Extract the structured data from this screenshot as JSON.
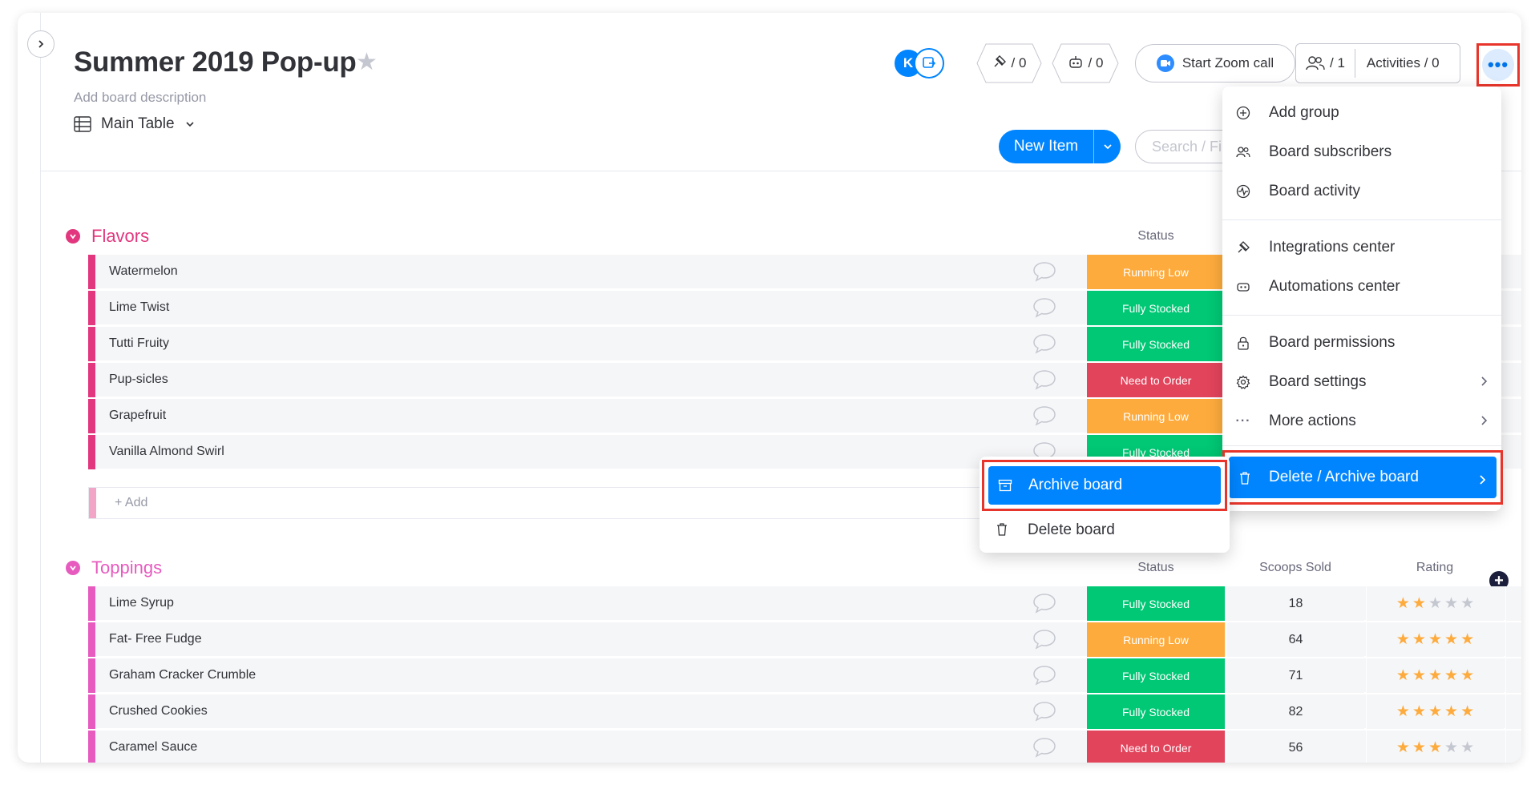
{
  "board": {
    "title": "Summer 2019 Pop-up",
    "description_placeholder": "Add board description",
    "avatar_initial": "K"
  },
  "header": {
    "integrations_count": "/ 0",
    "automations_count": "/ 0",
    "zoom_label": "Start Zoom call",
    "members_count": "/ 1",
    "activities_label": "Activities / 0"
  },
  "view": {
    "name": "Main Table"
  },
  "toolbar": {
    "new_item": "New Item",
    "search_placeholder": "Search / Fi"
  },
  "groups": [
    {
      "name": "Flavors",
      "color": "#e2445c",
      "bar_color": "#e2377e",
      "status_header": "Status",
      "add_label": "+ Add",
      "rows": [
        {
          "name": "Watermelon",
          "status": "Running Low",
          "status_color": "#fdab3d"
        },
        {
          "name": "Lime Twist",
          "status": "Fully Stocked",
          "status_color": "#00c875"
        },
        {
          "name": "Tutti Fruity",
          "status": "Fully Stocked",
          "status_color": "#00c875"
        },
        {
          "name": "Pup-sicles",
          "status": "Need to Order",
          "status_color": "#e2445c"
        },
        {
          "name": "Grapefruit",
          "status": "Running Low",
          "status_color": "#fdab3d"
        },
        {
          "name": "Vanilla Almond Swirl",
          "status": "Fully Stocked",
          "status_color": "#00c875"
        }
      ]
    },
    {
      "name": "Toppings",
      "color": "#ff5ac4",
      "bar_color": "#e75bbf",
      "status_header": "Status",
      "scoops_header": "Scoops Sold",
      "rating_header": "Rating",
      "rows": [
        {
          "name": "Lime Syrup",
          "status": "Fully Stocked",
          "status_color": "#00c875",
          "scoops": "18",
          "rating": 2
        },
        {
          "name": "Fat- Free Fudge",
          "status": "Running Low",
          "status_color": "#fdab3d",
          "scoops": "64",
          "rating": 5
        },
        {
          "name": "Graham Cracker Crumble",
          "status": "Fully Stocked",
          "status_color": "#00c875",
          "scoops": "71",
          "rating": 5
        },
        {
          "name": "Crushed Cookies",
          "status": "Fully Stocked",
          "status_color": "#00c875",
          "scoops": "82",
          "rating": 5
        },
        {
          "name": "Caramel Sauce",
          "status": "Need to Order",
          "status_color": "#e2445c",
          "scoops": "56",
          "rating": 3
        }
      ]
    }
  ],
  "menu": {
    "items": [
      {
        "label": "Add group",
        "icon": "plus-circle-icon"
      },
      {
        "label": "Board subscribers",
        "icon": "subscribers-icon"
      },
      {
        "label": "Board activity",
        "icon": "activity-icon"
      },
      {
        "label": "Integrations center",
        "icon": "integrations-icon"
      },
      {
        "label": "Automations center",
        "icon": "robot-icon"
      },
      {
        "label": "Board permissions",
        "icon": "lock-icon"
      },
      {
        "label": "Board settings",
        "icon": "gear-icon"
      },
      {
        "label": "More actions",
        "icon": "ellipsis-icon"
      }
    ],
    "delete_archive": "Delete / Archive board"
  },
  "submenu": {
    "archive": "Archive board",
    "delete": "Delete board"
  },
  "colors": {
    "primary": "#0085ff",
    "highlight_border": "#e8352b",
    "star_filled": "#fdab3d",
    "star_empty": "#c5c7d0"
  }
}
